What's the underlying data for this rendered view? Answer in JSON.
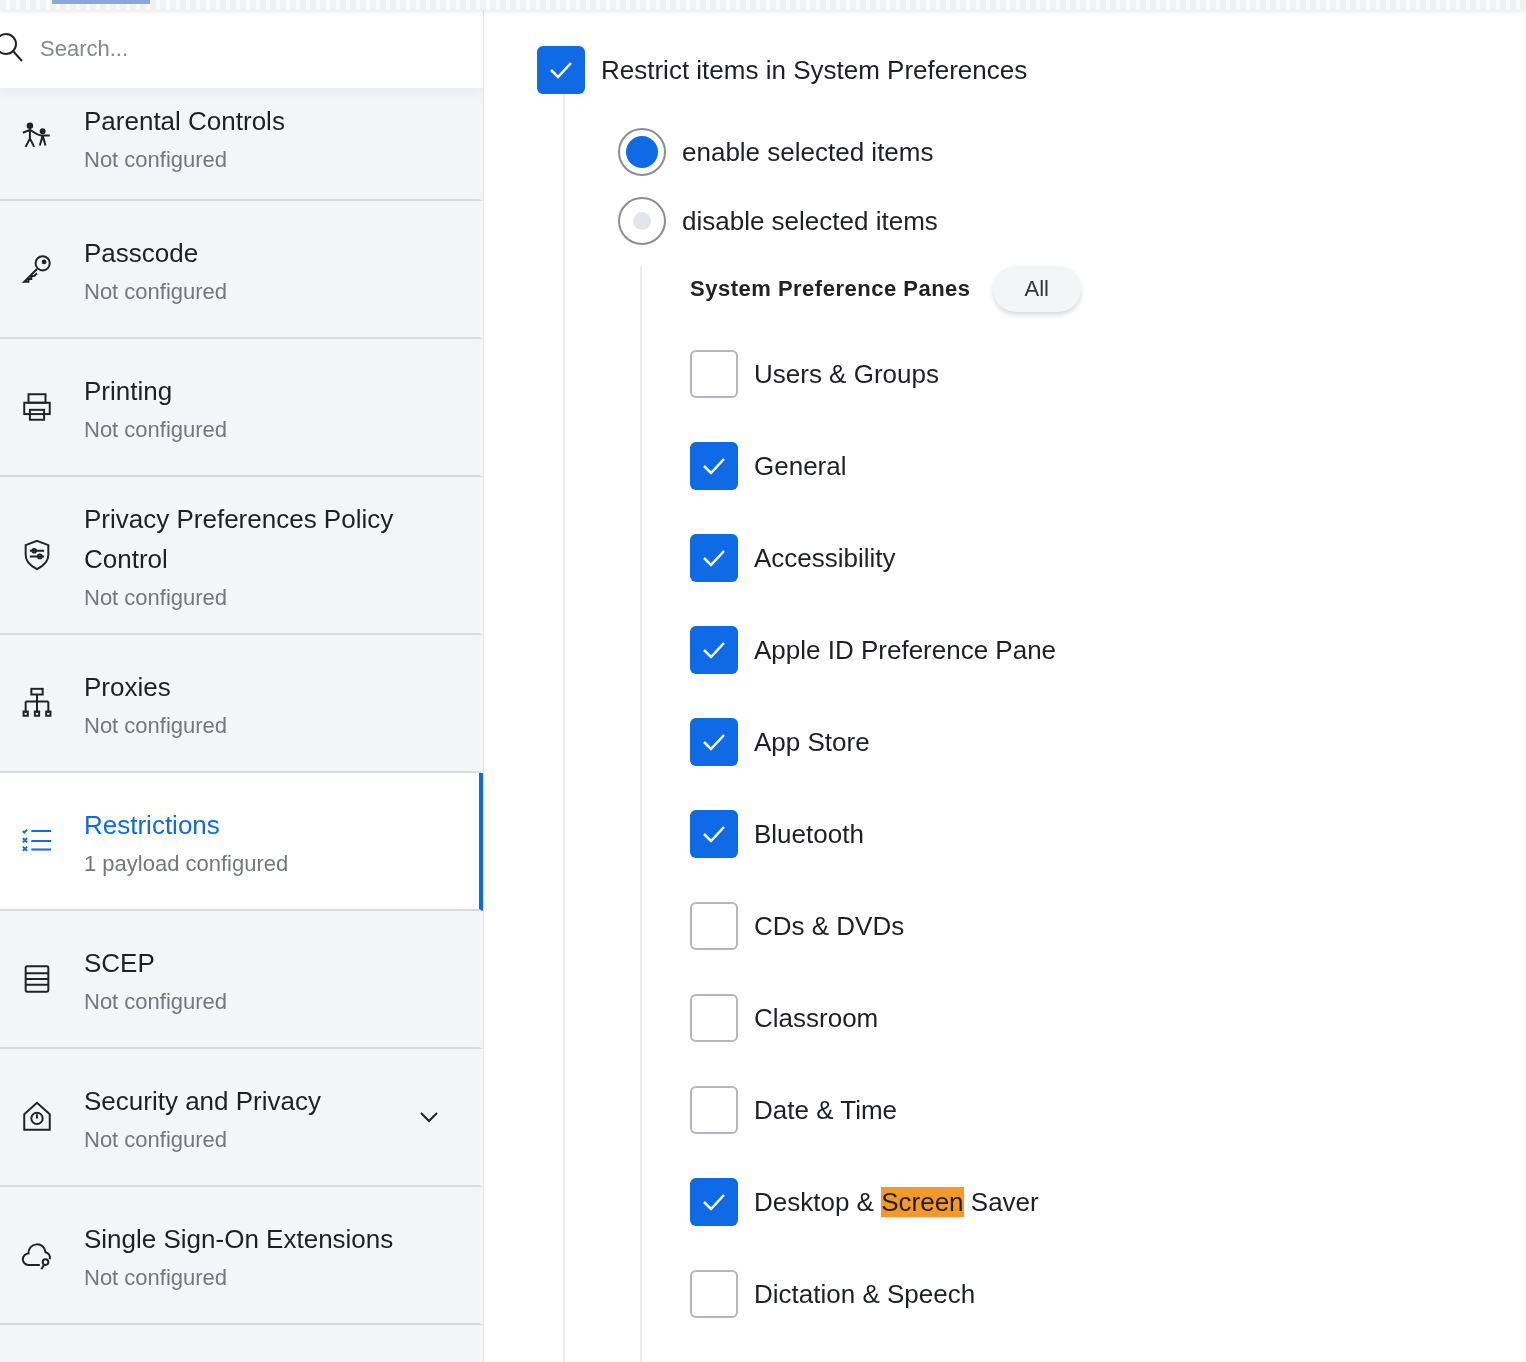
{
  "search": {
    "placeholder": "Search..."
  },
  "sidebar": {
    "items": [
      {
        "title": "Parental Controls",
        "status": "Not configured",
        "selected": false,
        "expandable": false
      },
      {
        "title": "Passcode",
        "status": "Not configured",
        "selected": false,
        "expandable": false
      },
      {
        "title": "Printing",
        "status": "Not configured",
        "selected": false,
        "expandable": false
      },
      {
        "title": "Privacy Preferences Policy Control",
        "status": "Not configured",
        "selected": false,
        "expandable": false
      },
      {
        "title": "Proxies",
        "status": "Not configured",
        "selected": false,
        "expandable": false
      },
      {
        "title": "Restrictions",
        "status": "1 payload configured",
        "selected": true,
        "expandable": false
      },
      {
        "title": "SCEP",
        "status": "Not configured",
        "selected": false,
        "expandable": false
      },
      {
        "title": "Security and Privacy",
        "status": "Not configured",
        "selected": false,
        "expandable": true
      },
      {
        "title": "Single Sign-On Extensions",
        "status": "Not configured",
        "selected": false,
        "expandable": false
      }
    ]
  },
  "restrict": {
    "label": "Restrict items in System Preferences",
    "checked": true
  },
  "mode": [
    {
      "label": "enable selected items",
      "selected": true
    },
    {
      "label": "disable selected items",
      "selected": false
    }
  ],
  "panes": {
    "heading": "System Preference Panes",
    "all_button": "All",
    "items": [
      {
        "label": "Users & Groups",
        "checked": false
      },
      {
        "label": "General",
        "checked": true
      },
      {
        "label": "Accessibility",
        "checked": true
      },
      {
        "label": "Apple ID Preference Pane",
        "checked": true
      },
      {
        "label": "App Store",
        "checked": true
      },
      {
        "label": "Bluetooth",
        "checked": true
      },
      {
        "label": "CDs & DVDs",
        "checked": false
      },
      {
        "label": "Classroom",
        "checked": false
      },
      {
        "label": "Date & Time",
        "checked": false
      },
      {
        "label_parts": [
          {
            "text": "Desktop & ",
            "highlighted": false
          },
          {
            "text": "Screen",
            "highlighted": true
          },
          {
            "text": " Saver",
            "highlighted": false
          }
        ],
        "checked": true
      },
      {
        "label": "Dictation & Speech",
        "checked": false
      }
    ]
  }
}
